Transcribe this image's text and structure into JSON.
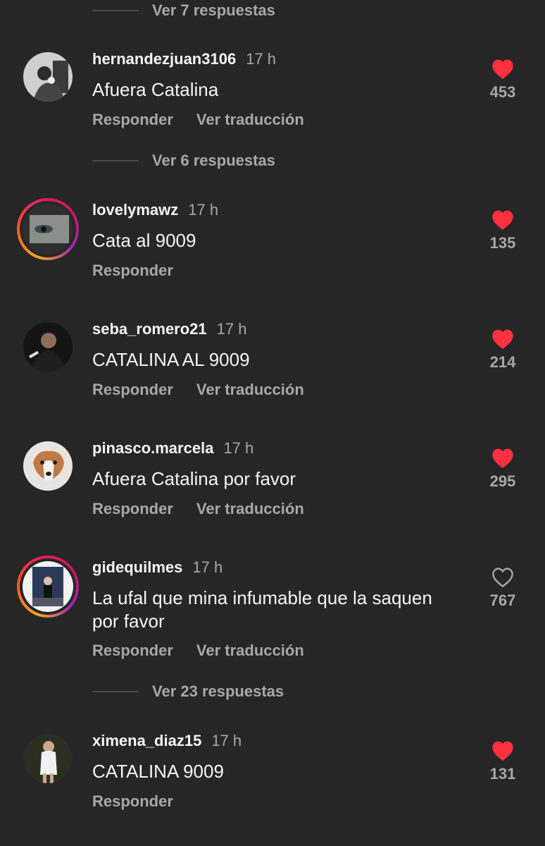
{
  "top_replies": "Ver 7 respuestas",
  "comments": [
    {
      "username": "hernandezjuan3106",
      "time": "17 h",
      "text": "Afuera Catalina",
      "reply": "Responder",
      "translate": "Ver traducción",
      "likes": "453",
      "liked": true,
      "replies": "Ver 6 respuestas"
    },
    {
      "username": "lovelymawz",
      "time": "17 h",
      "text": "Cata al 9009",
      "reply": "Responder",
      "likes": "135",
      "liked": true
    },
    {
      "username": "seba_romero21",
      "time": "17 h",
      "text": "CATALINA AL 9009",
      "reply": "Responder",
      "translate": "Ver traducción",
      "likes": "214",
      "liked": true
    },
    {
      "username": "pinasco.marcela",
      "time": "17 h",
      "text": "Afuera Catalina por favor",
      "reply": "Responder",
      "translate": "Ver traducción",
      "likes": "295",
      "liked": true
    },
    {
      "username": "gidequilmes",
      "time": "17 h",
      "text_line1": "La ufal que mina infumable que la saquen",
      "text_line2": "por favor",
      "reply": "Responder",
      "translate": "Ver traducción",
      "likes": "767",
      "liked": false,
      "replies": "Ver 23 respuestas"
    },
    {
      "username": "ximena_diaz15",
      "time": "17 h",
      "text": "CATALINA 9009",
      "reply": "Responder",
      "likes": "131",
      "liked": true
    }
  ],
  "colors": {
    "background": "#262626",
    "like_red": "#ff3040",
    "secondary_text": "#a8a8a8"
  }
}
